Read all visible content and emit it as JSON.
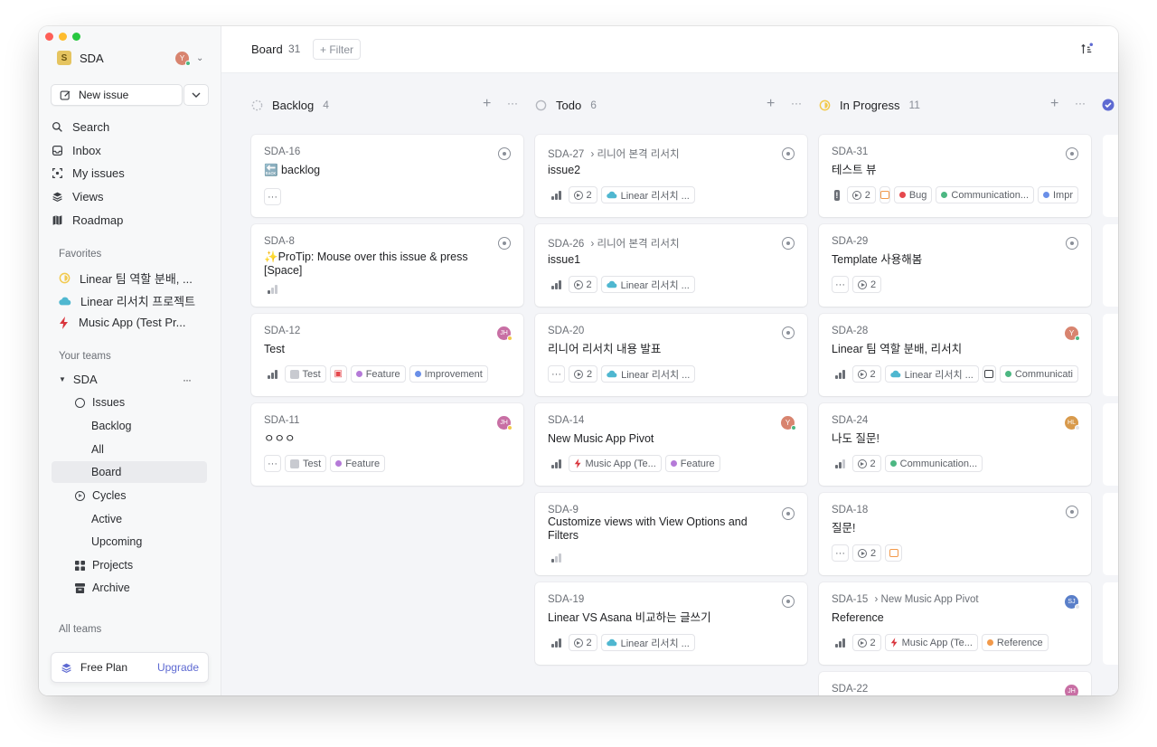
{
  "sidebar": {
    "workspace": "SDA",
    "workspace_initial": "S",
    "user_initial": "Y",
    "new_issue": "New issue",
    "nav": [
      {
        "label": "Search",
        "icon": "search-icon"
      },
      {
        "label": "Inbox",
        "icon": "inbox-icon"
      },
      {
        "label": "My issues",
        "icon": "my-issues-icon"
      },
      {
        "label": "Views",
        "icon": "views-icon"
      },
      {
        "label": "Roadmap",
        "icon": "roadmap-icon"
      }
    ],
    "favorites_label": "Favorites",
    "favorites": [
      {
        "label": "Linear 팀 역할 분배, ...",
        "icon": "in-progress-icon"
      },
      {
        "label": "Linear 리서치 프로젝트",
        "icon": "cloud-icon"
      },
      {
        "label": "Music App (Test Pr...",
        "icon": "bolt-icon"
      }
    ],
    "your_teams_label": "Your teams",
    "team": "SDA",
    "team_more": "···",
    "issues": "Issues",
    "issue_views": [
      "Backlog",
      "All",
      "Board"
    ],
    "cycles": "Cycles",
    "cycle_views": [
      "Active",
      "Upcoming"
    ],
    "projects": "Projects",
    "archive": "Archive",
    "all_teams_label": "All teams",
    "plan": "Free Plan",
    "upgrade": "Upgrade"
  },
  "header": {
    "title": "Board",
    "count": "31",
    "filter": "+ Filter"
  },
  "columns": [
    {
      "name": "Backlog",
      "count": "4",
      "status": "backlog-icon"
    },
    {
      "name": "Todo",
      "count": "6",
      "status": "todo-icon"
    },
    {
      "name": "In Progress",
      "count": "11",
      "status": "in-progress-icon"
    }
  ],
  "cards": {
    "backlog": [
      {
        "id": "SDA-16",
        "title": "🔙 backlog",
        "more": "···"
      },
      {
        "id": "SDA-8",
        "title": "✨ProTip: Mouse over this issue & press [Space]"
      },
      {
        "id": "SDA-12",
        "title": "Test",
        "avatar": "JH",
        "chips": [
          "Test",
          "Feature",
          "Improvement"
        ]
      },
      {
        "id": "SDA-11",
        "title": "ㅇㅇㅇ",
        "avatar": "JH",
        "more": "···",
        "chips": [
          "Test",
          "Feature"
        ]
      }
    ],
    "todo": [
      {
        "id": "SDA-27",
        "parent": "리니어 본격 리서치",
        "title": "issue2",
        "est": "2",
        "chips": [
          "Linear 리서치 ..."
        ]
      },
      {
        "id": "SDA-26",
        "parent": "리니어 본격 리서치",
        "title": "issue1",
        "est": "2",
        "chips": [
          "Linear 리서치 ..."
        ]
      },
      {
        "id": "SDA-20",
        "title": "리니어 리서치 내용 발표",
        "more": "···",
        "est": "2",
        "chips": [
          "Linear 리서치 ..."
        ]
      },
      {
        "id": "SDA-14",
        "title": "New Music App Pivot",
        "avatar": "Y",
        "chips": [
          "Music App (Te...",
          "Feature"
        ]
      },
      {
        "id": "SDA-9",
        "title": "Customize views with View Options and Filters"
      },
      {
        "id": "SDA-19",
        "title": "Linear VS Asana 비교하는 글쓰기",
        "est": "2",
        "chips": [
          "Linear 리서치 ..."
        ]
      }
    ],
    "in_progress": [
      {
        "id": "SDA-31",
        "title": "테스트 뷰",
        "est": "2",
        "chips": [
          "Bug",
          "Communication...",
          "Impr"
        ]
      },
      {
        "id": "SDA-29",
        "title": "Template 사용해봄",
        "more": "···",
        "est": "2"
      },
      {
        "id": "SDA-28",
        "title": "Linear 팀 역할 분배, 리서치",
        "avatar": "Y",
        "est": "2",
        "chips": [
          "Linear 리서치 ...",
          "Communicati"
        ]
      },
      {
        "id": "SDA-24",
        "title": "나도 질문!",
        "avatar": "HL",
        "est": "2",
        "chips": [
          "Communication..."
        ]
      },
      {
        "id": "SDA-18",
        "title": "질문!",
        "more": "···",
        "est": "2"
      },
      {
        "id": "SDA-15",
        "parent": "New Music App Pivot",
        "title": "Reference",
        "avatar": "SJ",
        "est": "2",
        "chips": [
          "Music App (Te...",
          "Reference"
        ]
      },
      {
        "id": "SDA-22",
        "avatar": "JH"
      }
    ]
  },
  "colors": {
    "accent": "#5e6ad2",
    "feature": "#b57ad8",
    "improvement": "#6a8fe8",
    "bug": "#e5484d",
    "communication": "#4cb782",
    "reference": "#f2994a",
    "linear_cloud": "#4fb7d0",
    "bolt": "#d9363e"
  }
}
